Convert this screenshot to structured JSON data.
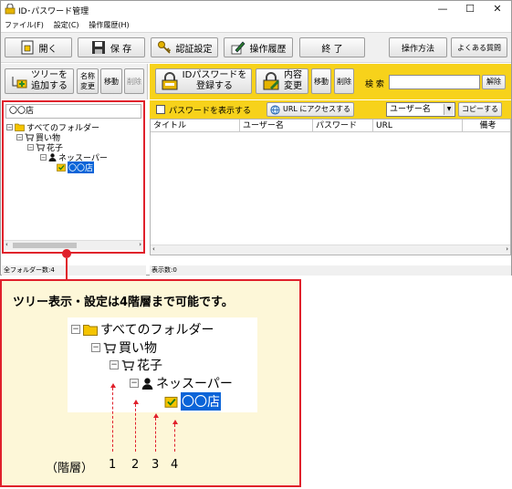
{
  "window": {
    "title": "ID･パスワード管理",
    "controls": [
      "—",
      "☐",
      "✕"
    ]
  },
  "menu": [
    "ファイル(F)",
    "設定(C)",
    "操作履歴(H)"
  ],
  "toolbar": {
    "open": "開く",
    "save": "保 存",
    "auth": "認証設定",
    "history": "操作履歴",
    "exit": "終 了",
    "howto": "操作方法",
    "faq": "よくある質問"
  },
  "tree_toolbar": {
    "add_tree": [
      "ツリーを",
      "追加する"
    ],
    "rename": [
      "名称",
      "変更"
    ],
    "move": "移動",
    "delete": "削除"
  },
  "entry_toolbar": {
    "register": [
      "IDパスワードを",
      "登録する"
    ],
    "edit": [
      "内容",
      "変更"
    ],
    "move": "移動",
    "delete": "削除",
    "search_label": "検 索",
    "search_value": "",
    "search_button": "解除"
  },
  "options_bar": {
    "show_password": "パスワードを表示する",
    "url_access": "URL にアクセスする",
    "column_select": "ユーザー名",
    "copy": "コピーする"
  },
  "tree": {
    "path": "〇〇店",
    "nodes": [
      "すべてのフォルダー",
      "買い物",
      "花子",
      "ネッスーパー",
      "〇〇店"
    ]
  },
  "table": {
    "columns": [
      "タイトル",
      "ユーザー名",
      "パスワード",
      "URL",
      "備考"
    ]
  },
  "status": {
    "left": "全フォルダー数:4",
    "right": "表示数:0"
  },
  "callout": {
    "title": "ツリー表示・設定は4階層まで可能です。",
    "levels_label": "（階層）",
    "levels": [
      "1",
      "2",
      "3",
      "4"
    ]
  },
  "colors": {
    "accent_yellow": "#f7d21b",
    "highlight_red": "#e0202b",
    "selection_blue": "#0a64d8"
  }
}
